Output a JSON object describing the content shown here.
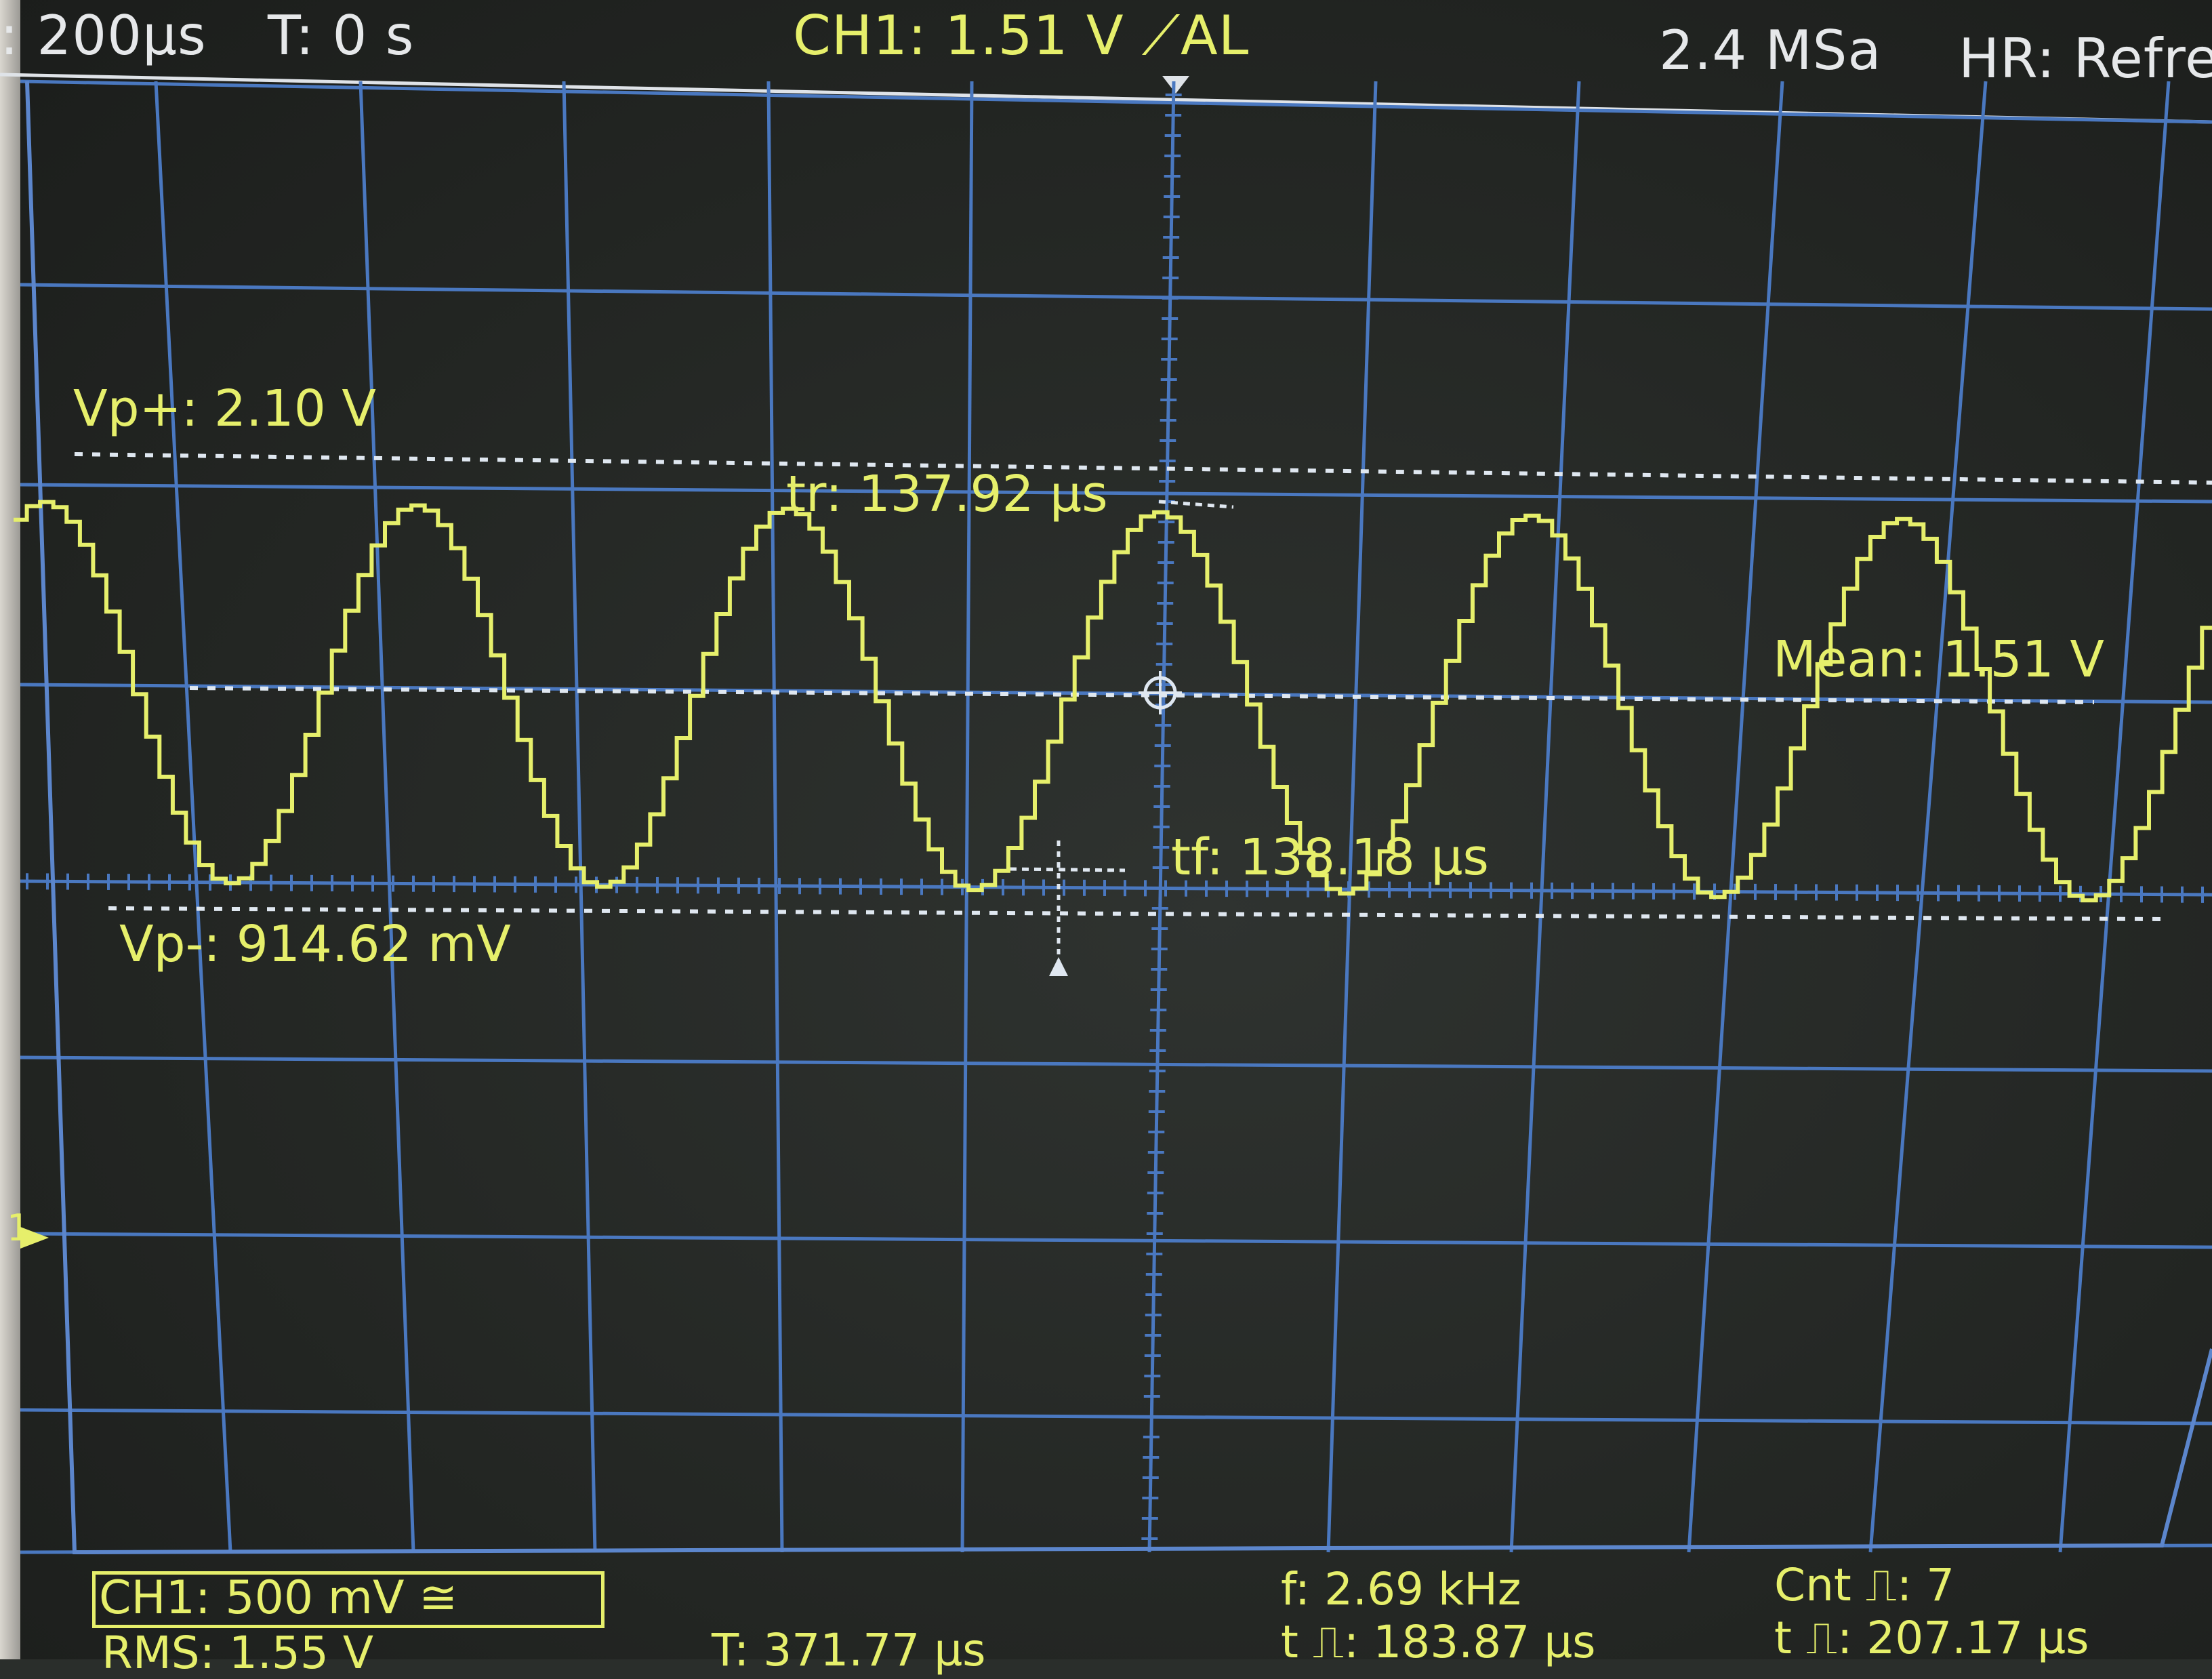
{
  "header": {
    "timebase": ": 200µs",
    "trigger_time": "T: 0 s",
    "channel_trigger": "CH1: 1.51 V",
    "trigger_mode": "AL",
    "sample_rate": "2.4 MSa",
    "acq_mode": "HR: Refres"
  },
  "measurements": {
    "vp_plus": "Vp+: 2.10 V",
    "vp_minus": "Vp-: 914.62 mV",
    "rise_time": "tr: 137.92 µs",
    "fall_time": "tf: 138.18 µs",
    "mean": "Mean: 1.51 V"
  },
  "channel_marker": "1",
  "footer": {
    "channel_scale": "CH1: 500 mV",
    "coupling_symbol": "≅",
    "rms": "RMS: 1.55 V",
    "period": "T: 371.77 µs",
    "frequency": "f: 2.69 kHz",
    "pos_width": "t ⎍: 183.87 µs",
    "count": "Cnt ⎍: 7",
    "neg_width": "t ⎍: 207.17 µs"
  },
  "colors": {
    "trace": "#e6ef6b",
    "grid": "#4a78c0",
    "cursor": "#dfe7f0",
    "text_white": "#e6e8ea"
  },
  "chart_data": {
    "type": "line",
    "title": "",
    "xlabel": "",
    "ylabel": "",
    "frequency_khz": 2.69,
    "period_us": 371.77,
    "vmax_v": 2.1,
    "vmin_v": 0.91462,
    "mean_v": 1.51,
    "rise_time_us": 137.92,
    "fall_time_us": 138.18,
    "grid": true
  }
}
